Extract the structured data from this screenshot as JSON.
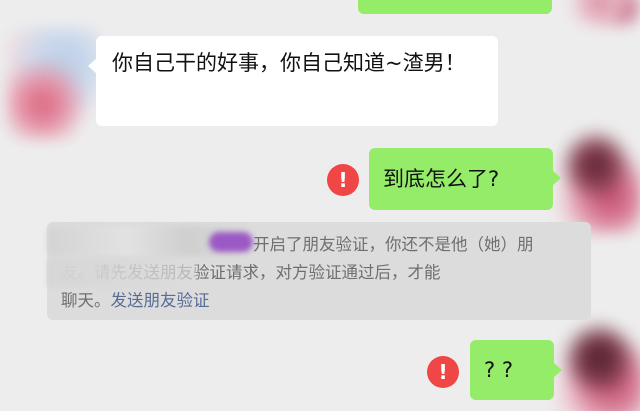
{
  "messages": {
    "received_1": "你自己干的好事，你自己知道~渣男！",
    "sent_1": "到底怎么了?",
    "sent_2": "? ?"
  },
  "fail_icon": {
    "glyph": "!",
    "color": "#f04646"
  },
  "system_notice": {
    "line1": "开启了朋友验证，你还不是他（她）朋",
    "line2": "友。请先发送朋友验证请求，对方验证通过后，才能",
    "line3_prefix": "聊天。",
    "link": "发送朋友验证"
  },
  "colors": {
    "sent_bubble": "#95ec69",
    "received_bubble": "#ffffff",
    "background": "#ededed",
    "notice_bg": "#dcdcdc",
    "link": "#576b95"
  }
}
